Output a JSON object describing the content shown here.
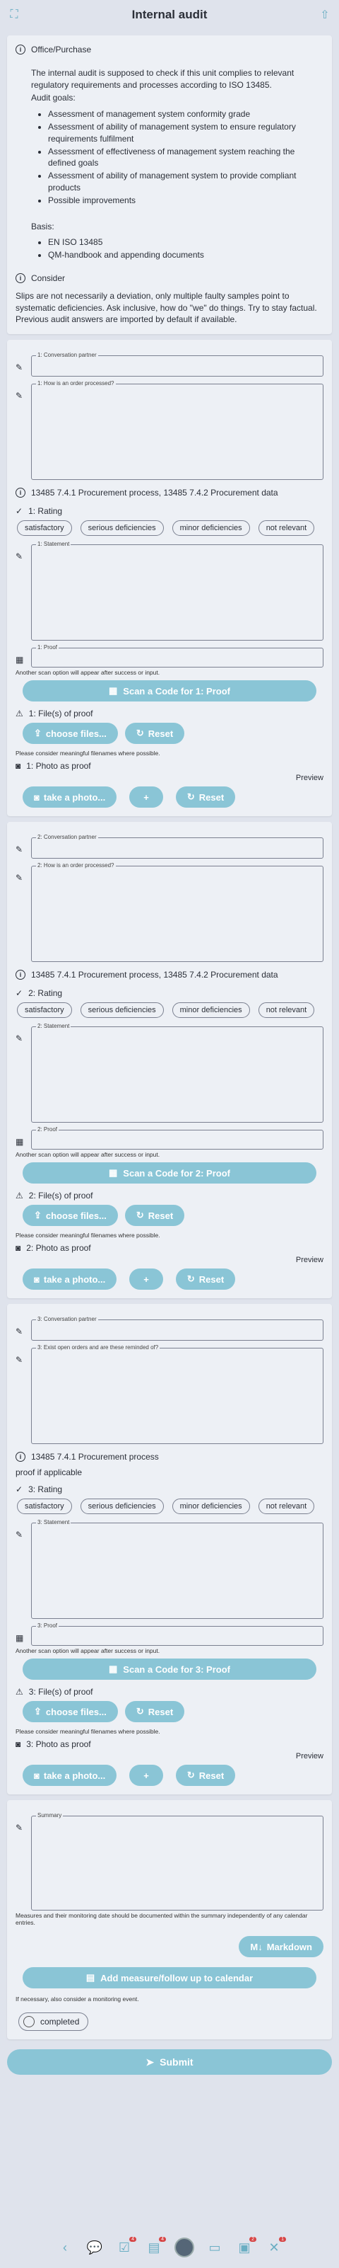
{
  "header": {
    "title": "Internal audit"
  },
  "info": {
    "office_label": "Office/Purchase",
    "intro": "The internal audit is supposed to check if this unit complies to relevant regulatory requirements and processes according to ISO 13485.",
    "goals_label": "Audit goals:",
    "goals": [
      "Assessment of management system conformity grade",
      "Assessment of ability of management system to ensure regulatory requirements fulfilment",
      "Assessment of effectiveness of management system reaching the defined goals",
      "Assessment of ability of management system to provide compliant products",
      "Possible improvements"
    ],
    "basis_label": "Basis:",
    "basis": [
      "EN ISO 13485",
      "QM-handbook and appending documents"
    ],
    "consider_label": "Consider",
    "consider_text": "Slips are not necessarily a deviation, only multiple faulty samples point to systematic deficiencies. Ask inclusive, how do \"we\" do things. Try to stay factual. Previous audit answers are imported by default if available."
  },
  "ratings": [
    "satisfactory",
    "serious deficiencies",
    "minor deficiencies",
    "not relevant"
  ],
  "common": {
    "scan_hint": "Another scan option will appear after success or input.",
    "files_hint": "Please consider meaningful filenames where possible.",
    "choose_files": "choose files...",
    "reset": "Reset",
    "take_photo": "take a photo...",
    "plus": "+",
    "preview": "Preview"
  },
  "sections": [
    {
      "partner": "1: Conversation partner",
      "question": "1: How is an order processed?",
      "reference": "13485 7.4.1 Procurement process, 13485 7.4.2 Procurement data",
      "rating": "1: Rating",
      "statement": "1: Statement",
      "proof": "1: Proof",
      "scan": "Scan a Code for 1: Proof",
      "files": "1: File(s) of proof",
      "photo": "1: Photo as proof"
    },
    {
      "partner": "2: Conversation partner",
      "question": "2: How is an order processed?",
      "reference": "13485 7.4.1 Procurement process, 13485 7.4.2 Procurement data",
      "rating": "2: Rating",
      "statement": "2: Statement",
      "proof": "2: Proof",
      "scan": "Scan a Code for 2: Proof",
      "files": "2: File(s) of proof",
      "photo": "2: Photo as proof"
    },
    {
      "partner": "3: Conversation partner",
      "question": "3: Exist open orders and are these reminded of?",
      "reference": "13485 7.4.1 Procurement process",
      "extra": "proof if applicable",
      "rating": "3: Rating",
      "statement": "3: Statement",
      "proof": "3: Proof",
      "scan": "Scan a Code for 3: Proof",
      "files": "3: File(s) of proof",
      "photo": "3: Photo as proof"
    }
  ],
  "summary": {
    "label": "Summary",
    "hint": "Measures and their monitoring date should be documented within the summary independently of any calendar entries.",
    "markdown": "Markdown",
    "add_measure": "Add measure/follow up to calendar",
    "monitoring_hint": "If necessary, also consider a monitoring event.",
    "completed": "completed"
  },
  "submit": "Submit",
  "nav": {
    "badges": [
      "4",
      "4",
      "2",
      "1"
    ]
  },
  "colors": {
    "accent": "#8ac5d6",
    "background": "#dfe3ec",
    "card": "#edf0f5"
  }
}
